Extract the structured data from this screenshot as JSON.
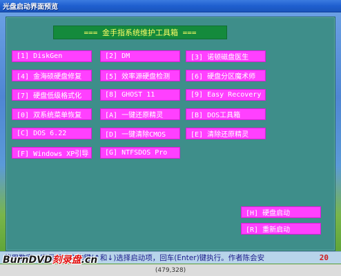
{
  "window": {
    "title": "光盘启动界面预览"
  },
  "banner": {
    "text": "=== 金手指系统维护工具箱 ==="
  },
  "menu": {
    "items": [
      {
        "label": "[1] DiskGen"
      },
      {
        "label": "[2] DM"
      },
      {
        "label": "[3] 诺顿磁盘医生"
      },
      {
        "label": "[4] 金海硕硬盘修复"
      },
      {
        "label": "[5] 效率源硬盘检测"
      },
      {
        "label": "[6] 硬盘分区魔术师"
      },
      {
        "label": "[7] 硬盘低级格式化"
      },
      {
        "label": "[8] GHOST 11"
      },
      {
        "label": "[9] Easy Recovery"
      },
      {
        "label": "[0] 双系统菜单恢复"
      },
      {
        "label": "[A] 一键还原精灵"
      },
      {
        "label": "[B] DOS工具箱"
      },
      {
        "label": "[C] DOS 6.22"
      },
      {
        "label": "[D] 一键清除CMOS"
      },
      {
        "label": "[E] 清除还原精灵"
      },
      {
        "label": "[F] Windows XP引导"
      },
      {
        "label": "[G] NTFSDOS Pro"
      }
    ],
    "boot_hdd": "[H] 硬盘启动",
    "reboot": "[R] 重新启动"
  },
  "status": {
    "text": "使用数字、字母键或方向键(↑和↓)选择启动项，回车(Enter)键执行。作者陈会安",
    "countdown": "20"
  },
  "coords": "(479,328)",
  "watermark": {
    "latin": "BurnDVD",
    "cn": "刻录盘",
    "suffix": ".cn"
  },
  "colors": {
    "panel": "#3e8e8a",
    "button": "#ff40ff",
    "banner": "#148a3c",
    "banner_text": "#ffff66"
  }
}
